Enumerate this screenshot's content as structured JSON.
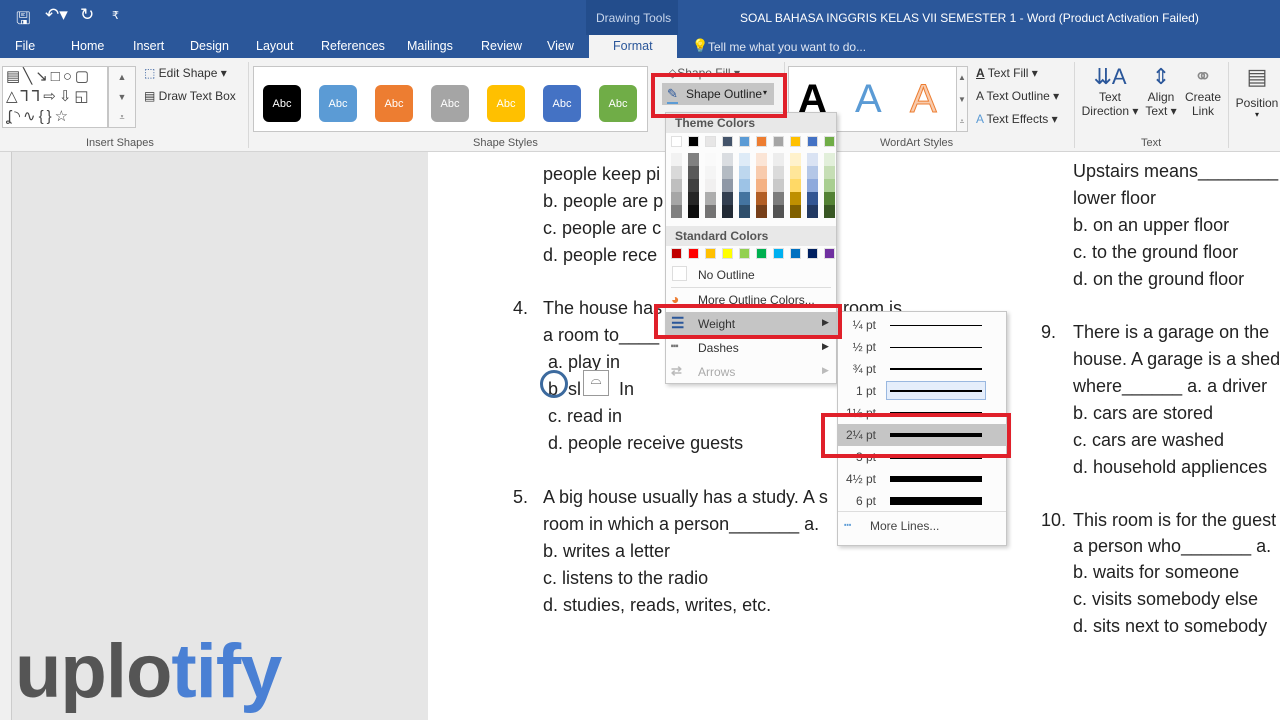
{
  "titlebar": {
    "context_tab": "Drawing Tools",
    "title": "SOAL BAHASA INGGRIS KELAS VII SEMESTER 1 - Word (Product Activation Failed)"
  },
  "tabs": [
    {
      "label": "File"
    },
    {
      "label": "Home"
    },
    {
      "label": "Insert"
    },
    {
      "label": "Design"
    },
    {
      "label": "Layout"
    },
    {
      "label": "References"
    },
    {
      "label": "Mailings"
    },
    {
      "label": "Review"
    },
    {
      "label": "View"
    },
    {
      "label": "Format",
      "active": true
    }
  ],
  "tell_me": "Tell me what you want to do...",
  "ribbon": {
    "insert_shapes": {
      "label": "Insert Shapes",
      "edit_shape": "Edit Shape",
      "draw_text_box": "Draw Text Box"
    },
    "shape_styles": {
      "label": "Shape Styles",
      "styles": [
        {
          "text": "Abc",
          "color": "#000000"
        },
        {
          "text": "Abc",
          "color": "#5b9bd5"
        },
        {
          "text": "Abc",
          "color": "#ed7d31"
        },
        {
          "text": "Abc",
          "color": "#a5a5a5"
        },
        {
          "text": "Abc",
          "color": "#ffc000"
        },
        {
          "text": "Abc",
          "color": "#4472c4"
        },
        {
          "text": "Abc",
          "color": "#70ad47"
        }
      ],
      "shape_fill": "Shape Fill",
      "shape_outline": "Shape Outline"
    },
    "wordart": {
      "label": "WordArt Styles",
      "text_fill": "Text Fill",
      "text_outline": "Text Outline",
      "text_effects": "Text Effects",
      "glyph": "A"
    },
    "text": {
      "label": "Text",
      "text_direction": [
        "Text",
        "Direction"
      ],
      "align_text": [
        "Align",
        "Text"
      ],
      "create_link": [
        "Create",
        "Link"
      ]
    },
    "arrange": {
      "position": "Position"
    }
  },
  "outline_menu": {
    "theme_colors_label": "Theme Colors",
    "theme_colors": [
      "#ffffff",
      "#000000",
      "#e7e6e6",
      "#44546a",
      "#5b9bd5",
      "#ed7d31",
      "#a5a5a5",
      "#ffc000",
      "#4472c4",
      "#70ad47"
    ],
    "standard_colors_label": "Standard Colors",
    "standard_colors": [
      "#c00000",
      "#ff0000",
      "#ffc000",
      "#ffff00",
      "#92d050",
      "#00b050",
      "#00b0f0",
      "#0070c0",
      "#002060",
      "#7030a0"
    ],
    "no_outline": "No Outline",
    "more_colors": "More Outline Colors...",
    "weight": "Weight",
    "dashes": "Dashes",
    "arrows": "Arrows"
  },
  "weight_menu": {
    "items": [
      {
        "label": "¼ pt"
      },
      {
        "label": "½ pt"
      },
      {
        "label": "¾ pt"
      },
      {
        "label": "1 pt",
        "current": true
      },
      {
        "label": "1½ pt"
      },
      {
        "label": "2¼ pt",
        "hover": true
      },
      {
        "label": "3 pt"
      },
      {
        "label": "4½ pt"
      },
      {
        "label": "6 pt"
      }
    ],
    "more_lines": "More Lines..."
  },
  "document": {
    "left": [
      "people keep pi",
      "b. people are p",
      "c. people are c",
      "d. people rece",
      "4.",
      "The house has",
      "room is",
      "a room to____",
      "a. play in",
      "b. sl",
      "In",
      "c. read in",
      "d. people receive guests",
      "5.",
      "A big house usually has a study. A s",
      "room in which a person_______ a.",
      "b. writes a letter",
      "c. listens to the radio",
      "d. studies, reads, writes, etc."
    ],
    "right": [
      "Upstairs means________",
      "lower floor",
      "b. on an upper floor",
      "c. to the ground floor",
      "d. on the ground floor",
      "9.",
      "There is a garage on the",
      "house. A garage is a shed",
      "where______ a. a driver",
      "b. cars are stored",
      "c. cars are washed",
      "d. household appliences",
      "10.",
      "This room is for the guest",
      "a person who_______ a.",
      "b. waits for someone",
      "c. visits somebody else",
      "d. sits next to somebody"
    ]
  },
  "watermark": {
    "part1": "uplo",
    "part2": "tify",
    "colors": [
      "#555555",
      "#4a80d4"
    ]
  }
}
